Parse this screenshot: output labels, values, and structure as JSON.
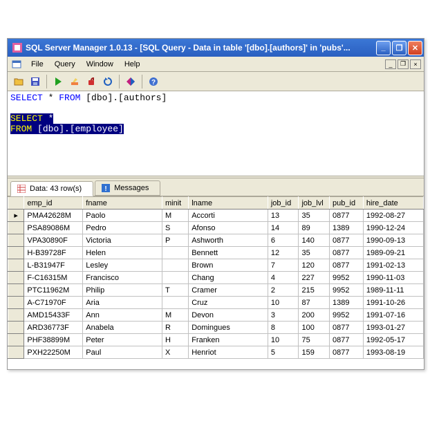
{
  "window": {
    "title": "SQL Server Manager 1.0.13 - [SQL Query - Data in table '[dbo].[authors]' in 'pubs'..."
  },
  "menu": {
    "file": "File",
    "query": "Query",
    "window": "Window",
    "help": "Help"
  },
  "sql": {
    "line1_kw": "SELECT",
    "line1_star": " * ",
    "line1_from": "FROM",
    "line1_table": " [dbo].[authors]",
    "sel1_kw": "SELECT",
    "sel1_rest": " *",
    "sel2_kw": "FROM",
    "sel2_rest": " [dbo].[employee]"
  },
  "tabs": {
    "data": "Data: 43 row(s)",
    "messages": "Messages"
  },
  "columns": {
    "emp_id": "emp_id",
    "fname": "fname",
    "minit": "minit",
    "lname": "lname",
    "job_id": "job_id",
    "job_lvl": "job_lvl",
    "pub_id": "pub_id",
    "hire_date": "hire_date"
  },
  "rows": [
    {
      "emp_id": "PMA42628M",
      "fname": "Paolo",
      "minit": "M",
      "lname": "Accorti",
      "job_id": "13",
      "job_lvl": "35",
      "pub_id": "0877",
      "hire_date": "1992-08-27"
    },
    {
      "emp_id": "PSA89086M",
      "fname": "Pedro",
      "minit": "S",
      "lname": "Afonso",
      "job_id": "14",
      "job_lvl": "89",
      "pub_id": "1389",
      "hire_date": "1990-12-24"
    },
    {
      "emp_id": "VPA30890F",
      "fname": "Victoria",
      "minit": "P",
      "lname": "Ashworth",
      "job_id": "6",
      "job_lvl": "140",
      "pub_id": "0877",
      "hire_date": "1990-09-13"
    },
    {
      "emp_id": "H-B39728F",
      "fname": "Helen",
      "minit": "",
      "lname": "Bennett",
      "job_id": "12",
      "job_lvl": "35",
      "pub_id": "0877",
      "hire_date": "1989-09-21"
    },
    {
      "emp_id": "L-B31947F",
      "fname": "Lesley",
      "minit": "",
      "lname": "Brown",
      "job_id": "7",
      "job_lvl": "120",
      "pub_id": "0877",
      "hire_date": "1991-02-13"
    },
    {
      "emp_id": "F-C16315M",
      "fname": "Francisco",
      "minit": "",
      "lname": "Chang",
      "job_id": "4",
      "job_lvl": "227",
      "pub_id": "9952",
      "hire_date": "1990-11-03"
    },
    {
      "emp_id": "PTC11962M",
      "fname": "Philip",
      "minit": "T",
      "lname": "Cramer",
      "job_id": "2",
      "job_lvl": "215",
      "pub_id": "9952",
      "hire_date": "1989-11-11"
    },
    {
      "emp_id": "A-C71970F",
      "fname": "Aria",
      "minit": "",
      "lname": "Cruz",
      "job_id": "10",
      "job_lvl": "87",
      "pub_id": "1389",
      "hire_date": "1991-10-26"
    },
    {
      "emp_id": "AMD15433F",
      "fname": "Ann",
      "minit": "M",
      "lname": "Devon",
      "job_id": "3",
      "job_lvl": "200",
      "pub_id": "9952",
      "hire_date": "1991-07-16"
    },
    {
      "emp_id": "ARD36773F",
      "fname": "Anabela",
      "minit": "R",
      "lname": "Domingues",
      "job_id": "8",
      "job_lvl": "100",
      "pub_id": "0877",
      "hire_date": "1993-01-27"
    },
    {
      "emp_id": "PHF38899M",
      "fname": "Peter",
      "minit": "H",
      "lname": "Franken",
      "job_id": "10",
      "job_lvl": "75",
      "pub_id": "0877",
      "hire_date": "1992-05-17"
    },
    {
      "emp_id": "PXH22250M",
      "fname": "Paul",
      "minit": "X",
      "lname": "Henriot",
      "job_id": "5",
      "job_lvl": "159",
      "pub_id": "0877",
      "hire_date": "1993-08-19"
    }
  ]
}
